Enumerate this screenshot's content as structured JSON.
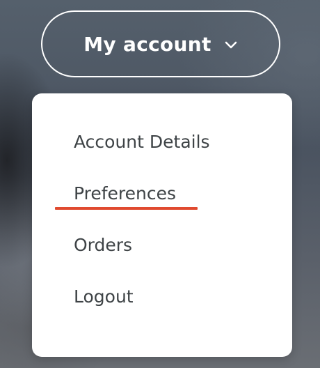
{
  "header": {
    "account_button_label": "My account",
    "chevron_icon": "chevron-down-icon"
  },
  "menu": {
    "items": [
      {
        "label": "Account Details",
        "active": false
      },
      {
        "label": "Preferences",
        "active": true
      },
      {
        "label": "Orders",
        "active": false
      },
      {
        "label": "Logout",
        "active": false
      }
    ]
  },
  "colors": {
    "accent": "#e04a2f",
    "menu_text": "#3e4346",
    "menu_background": "#ffffff",
    "button_border": "#ffffff"
  }
}
